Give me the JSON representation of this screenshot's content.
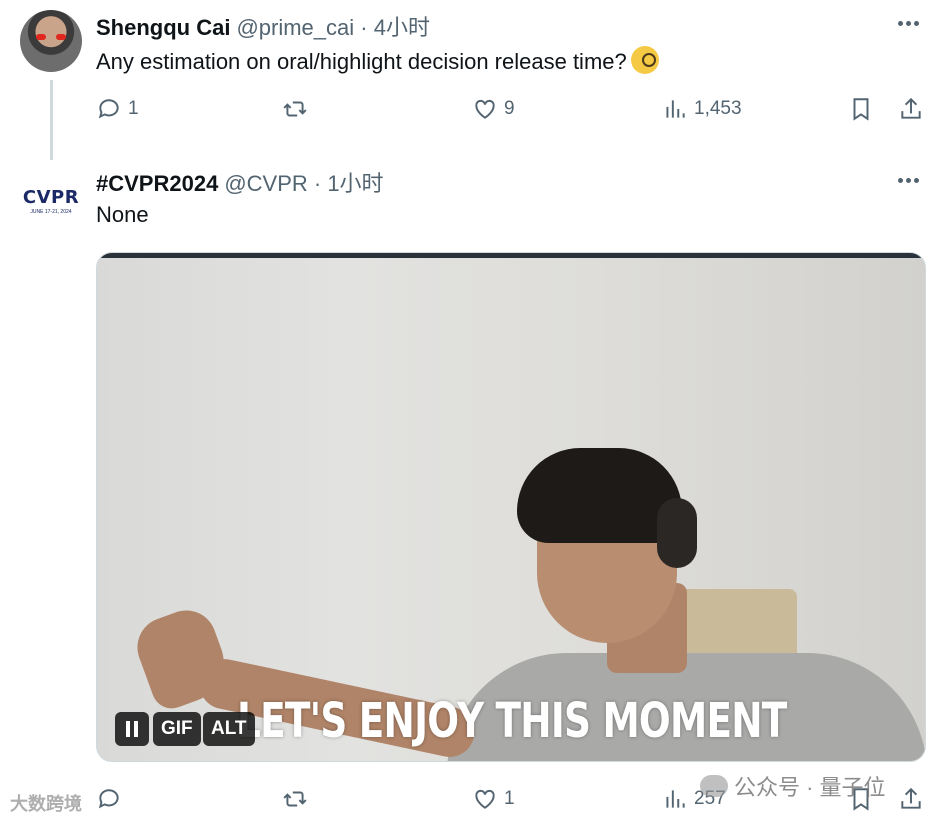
{
  "tweet1": {
    "name": "Shengqu Cai",
    "handle": "@prime_cai · 4小时",
    "text": "Any estimation on oral/highlight decision release time?",
    "emoji": "face-with-monocle",
    "replies": "1",
    "likes": "9",
    "views": "1,453"
  },
  "tweet2": {
    "name": "#CVPR2024",
    "handle": "@CVPR · 1小时",
    "text": "None",
    "avatar_logo": "CVPR",
    "avatar_sub": "JUNE 17-21, 2024",
    "media": {
      "caption": "LET'S ENJOY THIS MOMENT",
      "gif_badge": "GIF",
      "alt_badge": "ALT"
    },
    "likes": "1",
    "views": "257"
  },
  "watermarks": {
    "left": "大数跨境",
    "right": "公众号 · 量子位"
  },
  "colors": {
    "text": "#0f1419",
    "muted": "#536471",
    "thread_line": "#cfd9de",
    "cvpr_blue": "#1b2a66"
  }
}
